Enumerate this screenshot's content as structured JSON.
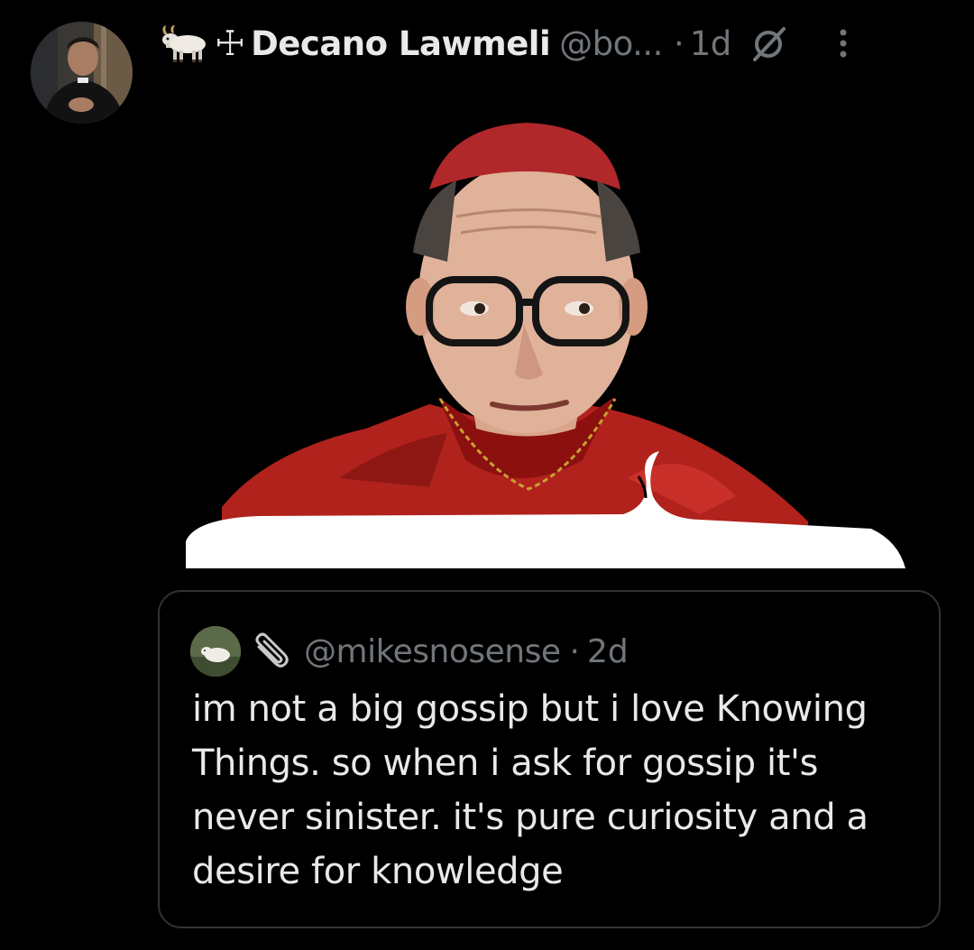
{
  "tweet": {
    "author": {
      "emoji": "goat",
      "symbol": "☩",
      "display_name": "Decano Lawmeli",
      "handle": "@bo...",
      "separator": "·",
      "age": "1d"
    },
    "icons": {
      "author_avatar": "avatar-priest",
      "grok": "grok-icon",
      "more": "more-vertical-icon"
    },
    "media": {
      "subject": "cardinal-speech-bubble-meme"
    },
    "quote": {
      "author": {
        "handle": "@mikesnosense",
        "separator": "·",
        "age": "2d"
      },
      "text": "im not a big gossip but i love Knowing Things. so when i ask for gossip it's never sinister. it's pure curiosity and a desire for knowledge"
    }
  },
  "colors": {
    "background": "#000000",
    "primary_text": "#e7e9ea",
    "secondary_text": "#71767b",
    "border": "#2f3336"
  }
}
